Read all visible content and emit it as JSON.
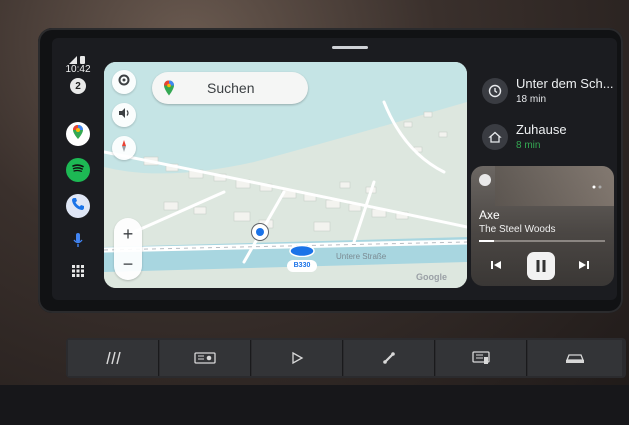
{
  "status": {
    "time": "10:42",
    "notification_count": "2"
  },
  "rail": {
    "apps": [
      {
        "name": "maps-icon",
        "color": "#ffffff"
      },
      {
        "name": "spotify-icon",
        "color": "#1db954"
      },
      {
        "name": "phone-icon",
        "color": "#4285f4"
      }
    ]
  },
  "map": {
    "search_placeholder": "Suchen",
    "street_label": "Untere Straße",
    "position_label": "B330",
    "attribution": "Google",
    "colors": {
      "water": "#a8d9e4",
      "land": "#dfe8e2",
      "road": "#ffffff",
      "accent": "#1a73e8"
    }
  },
  "destinations": [
    {
      "title": "Unter dem Sch...",
      "eta": "18 min",
      "eta_color": "#e8eaed",
      "icon": "history-icon"
    },
    {
      "title": "Zuhause",
      "eta": "8 min",
      "eta_color": "#34a853",
      "icon": "home-icon"
    }
  ],
  "media": {
    "track": "Axe",
    "artist": "The Steel Woods",
    "progress": 0.12
  },
  "hard_buttons": [
    "menu-lines-icon",
    "radio-icon",
    "play-icon",
    "phone-icon",
    "settings-screen-icon",
    "car-icon"
  ]
}
